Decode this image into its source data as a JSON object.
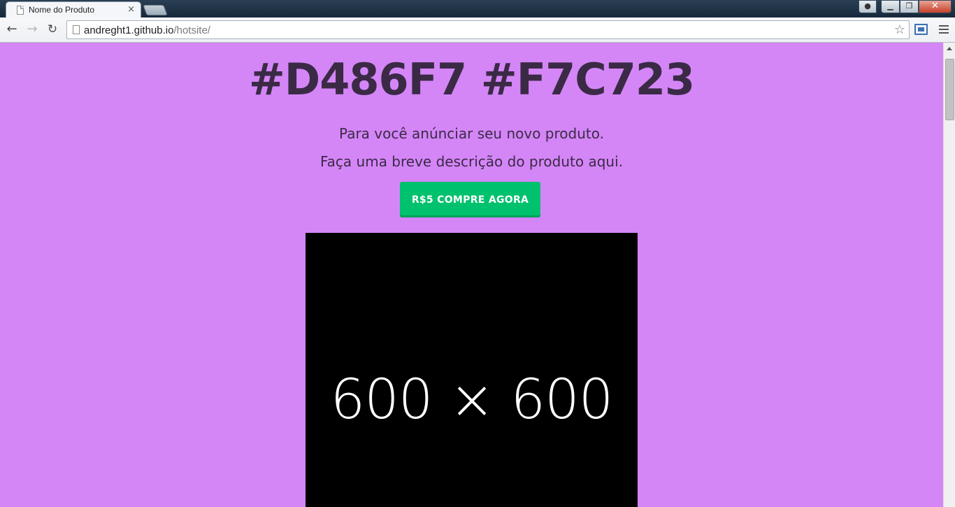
{
  "browser": {
    "tab_title": "Nome do Produto",
    "tab_close": "×",
    "url_host": "andreght1.github.io",
    "url_path": "/hotsite/",
    "icons": [
      "back-icon",
      "forward-icon",
      "reload-icon",
      "page-icon",
      "star-icon",
      "cast-icon",
      "menu-icon"
    ]
  },
  "window": {
    "close_glyph": "✕",
    "min_glyph": "▁",
    "max_glyph": "❐",
    "user_glyph": "👤"
  },
  "page": {
    "headline": "#D486F7 #F7C723",
    "description_line1": "Para você anúnciar seu novo produto.",
    "description_line2": "Faça uma breve descrição do produto aqui.",
    "buy_button": "R$5 COMPRE AGORA",
    "image_placeholder": "600 × 600",
    "background_color": "#D486F7",
    "button_color": "#00c16d"
  }
}
